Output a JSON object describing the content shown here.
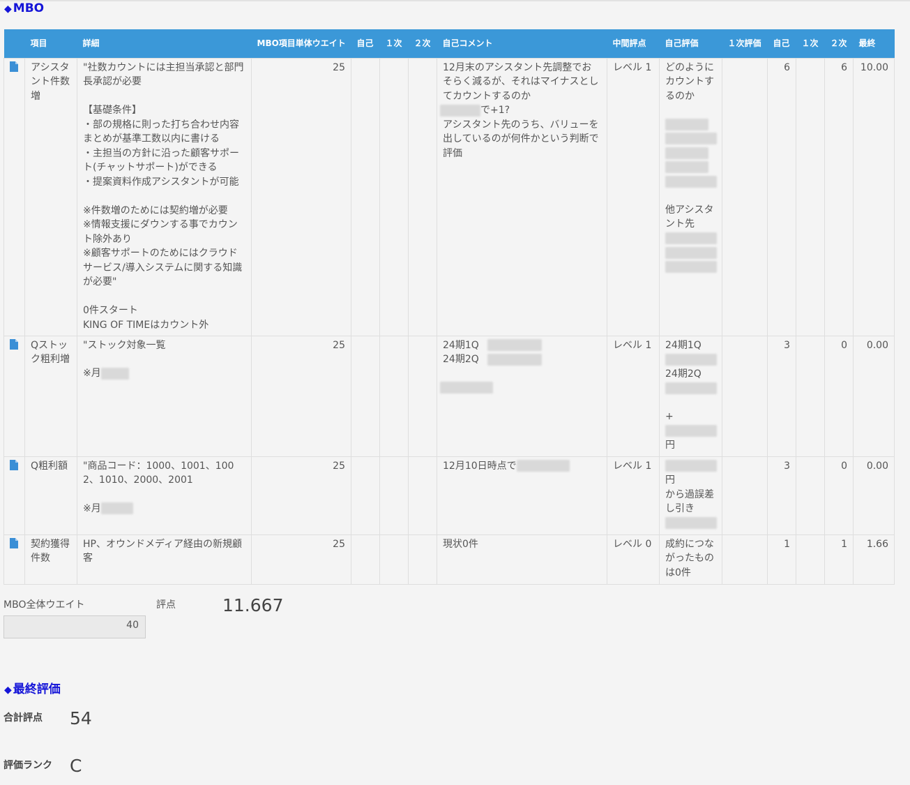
{
  "mbo_section": {
    "title": "MBO",
    "marker": "◆"
  },
  "table": {
    "headers": {
      "icon": "",
      "item": "項目",
      "detail": "詳細",
      "unit_weight": "MBO項目単体ウエイト",
      "self": "自己",
      "first": "１次",
      "second": "２次",
      "self_comment": "自己コメント",
      "mid_eval": "中間評点",
      "self_eval": "自己評価",
      "first_eval": "１次評価",
      "self2": "自己",
      "first2": "１次",
      "second2": "２次",
      "final": "最終"
    },
    "rows": [
      {
        "item": "アシスタント件数増",
        "detail": "\"社数カウントには主担当承認と部門長承認が必要\n\n【基礎条件】\n・部の規格に則った打ち合わせ内容まとめが基準工数以内に書ける\n・主担当の方針に沿った顧客サポート(チャットサポート)ができる\n・提案資料作成アシスタントが可能\n\n※件数増のためには契約増が必要\n※情報支援にダウンする事でカウント除外あり\n※顧客サポートのためにはクラウドサービス/導入システムに関する知識が必要\"\n\n0件スタート\nKING OF TIMEはカウント外",
        "weight": "25",
        "comment_a": "12月末のアシスタント先調整でおそらく減るが、それはマイナスとしてカウントするのか",
        "comment_b": "で+1?",
        "comment_c": "アシスタント先のうち、バリューを出しているのが何件かという判断で評価",
        "mid_eval": "レベル 1",
        "self_eval_a": "どのようにカウントするのか",
        "self_eval_b": "他アシスタント先",
        "self_score": "6",
        "second_score": "6",
        "final_score": "10.00"
      },
      {
        "item": "Qストック粗利増",
        "detail_a": "\"ストック対象一覧",
        "detail_b": "※月",
        "weight": "25",
        "comment_a": "24期1Q",
        "comment_b": "24期2Q",
        "mid_eval": "レベル 1",
        "self_eval_a": "24期1Q",
        "self_eval_b": "24期2Q",
        "self_eval_c": "+",
        "self_eval_d": "円",
        "self_score": "3",
        "second_score": "0",
        "final_score": "0.00"
      },
      {
        "item": "Q粗利額",
        "detail_a": "\"商品コード：1000、1001、1002、1010、2000、2001",
        "detail_b": "※月",
        "weight": "25",
        "comment_a": "12月10日時点で",
        "mid_eval": "レベル 1",
        "self_eval_a": "円",
        "self_eval_b": "から過誤差し引き",
        "self_score": "3",
        "second_score": "0",
        "final_score": "0.00"
      },
      {
        "item": "契約獲得件数",
        "detail": "HP、オウンドメディア経由の新規顧客",
        "weight": "25",
        "comment_a": "現状0件",
        "mid_eval": "レベル 0",
        "self_eval_a": "成約につながったものは0件",
        "self_score": "1",
        "second_score": "1",
        "final_score": "1.66"
      }
    ]
  },
  "summary": {
    "mbo_weight_label": "MBO全体ウエイト",
    "mbo_weight_value": "40",
    "score_label": "評点",
    "score_value": "11.667"
  },
  "final_section": {
    "title": "最終評価",
    "marker": "◆"
  },
  "final": {
    "total_label": "合計評点",
    "total_value": "54",
    "rank_label": "評価ランク",
    "rank_value": "C"
  },
  "colors": {
    "header_bg": "#3b98d8",
    "section_title": "#1515d8",
    "doc_icon": "#3b8fd6"
  },
  "icons": {
    "row_icon": "document-icon"
  }
}
